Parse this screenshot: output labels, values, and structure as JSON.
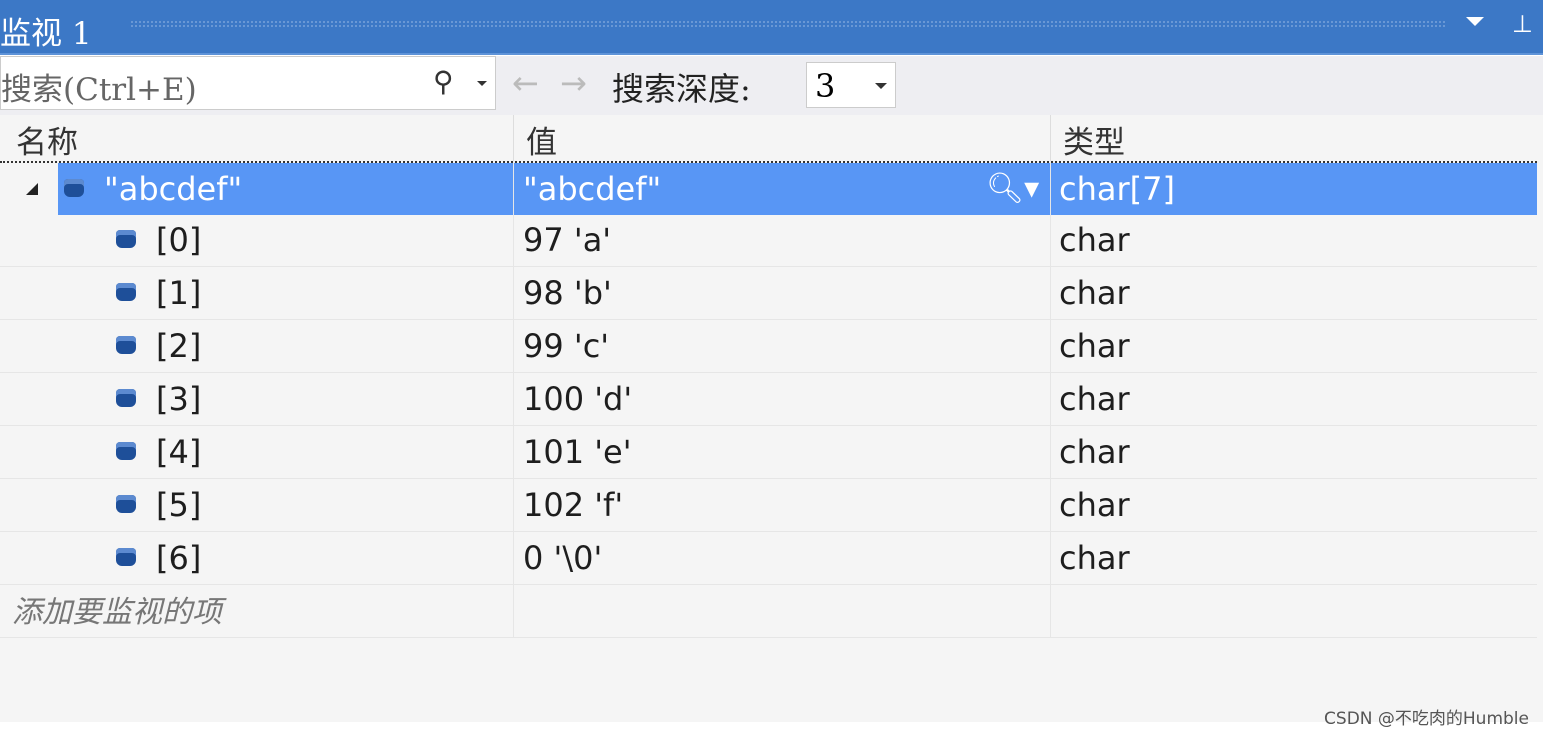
{
  "window": {
    "title": "监视 1",
    "menu_icon": "dropdown-arrow-icon",
    "pin_icon": "pin-icon"
  },
  "toolbar": {
    "search_placeholder": "搜索(Ctrl+E)",
    "back_icon": "←",
    "forward_icon": "→",
    "depth_label": "搜索深度:",
    "depth_value": "3"
  },
  "columns": {
    "name": "名称",
    "value": "值",
    "type": "类型"
  },
  "rows": [
    {
      "name": "\"abcdef\"",
      "value": "\"abcdef\"",
      "type": "char[7]",
      "expanded": true,
      "selected": true
    },
    {
      "name": "[0]",
      "value": "97 'a'",
      "type": "char"
    },
    {
      "name": "[1]",
      "value": "98 'b'",
      "type": "char"
    },
    {
      "name": "[2]",
      "value": "99 'c'",
      "type": "char"
    },
    {
      "name": "[3]",
      "value": "100 'd'",
      "type": "char"
    },
    {
      "name": "[4]",
      "value": "101 'e'",
      "type": "char"
    },
    {
      "name": "[5]",
      "value": "102 'f'",
      "type": "char"
    },
    {
      "name": "[6]",
      "value": "0 '\\0'",
      "type": "char"
    }
  ],
  "add_watch": "添加要监视的项",
  "watermark": "CSDN @不吃肉的Humble",
  "colors": {
    "titlebar": "#3c78c6",
    "selection": "#5896f5",
    "background": "#f5f5f5"
  }
}
